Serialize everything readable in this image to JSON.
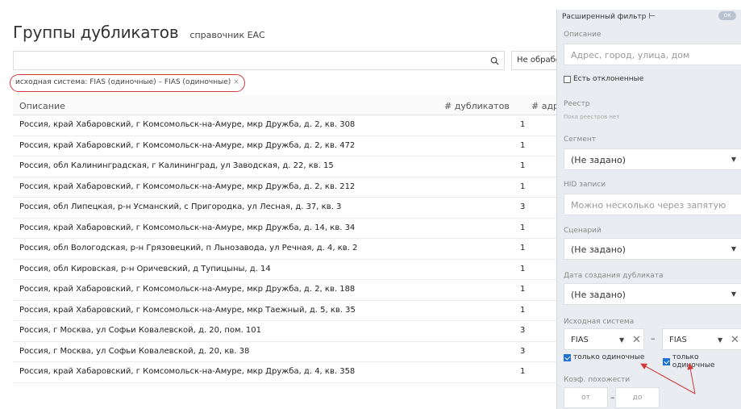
{
  "page": {
    "title": "Группы дубликатов",
    "subtitle": "справочник ЕАС"
  },
  "search": {
    "placeholder": "",
    "status_label": "Не обработ"
  },
  "icons": {
    "search": "search-icon",
    "pin": "pin-icon",
    "close": "close-icon",
    "chevron": "chevron-down-icon"
  },
  "filter_chip": {
    "label": "исходная система: FIAS (одиночные) – FIAS (одиночные)",
    "close": "×"
  },
  "table": {
    "columns": [
      "Описание",
      "# дубликатов",
      "# адре"
    ],
    "rows": [
      {
        "desc": "Россия, край Хабаровский, г Комсомольск-на-Амуре, мкр Дружба, д. 2, кв. 308",
        "count": "1"
      },
      {
        "desc": "Россия, край Хабаровский, г Комсомольск-на-Амуре, мкр Дружба, д. 2, кв. 472",
        "count": "1"
      },
      {
        "desc": "Россия, обл Калининградская, г Калининград, ул Заводская, д. 22, кв. 15",
        "count": "1"
      },
      {
        "desc": "Россия, край Хабаровский, г Комсомольск-на-Амуре, мкр Дружба, д. 2, кв. 212",
        "count": "1"
      },
      {
        "desc": "Россия, обл Липецкая, р-н Усманский, с Пригородка, ул Лесная, д. 37, кв. 3",
        "count": "3"
      },
      {
        "desc": "Россия, край Хабаровский, г Комсомольск-на-Амуре, мкр Дружба, д. 14, кв. 34",
        "count": "1"
      },
      {
        "desc": "Россия, обл Вологодская, р-н Грязовецкий, п Льнозавода, ул Речная, д. 4, кв. 2",
        "count": "1"
      },
      {
        "desc": "Россия, обл Кировская, р-н Оричевский, д Тупицыны, д. 14",
        "count": "1"
      },
      {
        "desc": "Россия, край Хабаровский, г Комсомольск-на-Амуре, мкр Дружба, д. 2, кв. 188",
        "count": "1"
      },
      {
        "desc": "Россия, край Хабаровский, г Комсомольск-на-Амуре, мкр Таежный, д. 5, кв. 35",
        "count": "1"
      },
      {
        "desc": "Россия, г Москва, ул Софьи Ковалевской, д. 20, пом. 101",
        "count": "3"
      },
      {
        "desc": "Россия, г Москва, ул Софьи Ковалевской, д. 20, кв. 38",
        "count": "3"
      },
      {
        "desc": "Россия, край Хабаровский, г Комсомольск-на-Амуре, мкр Дружба, д. 4, кв. 358",
        "count": "1"
      }
    ]
  },
  "panel": {
    "title": "Расширенный фильтр",
    "ok_label": "ОК",
    "description_label": "Описание",
    "description_placeholder": "Адрес, город, улица, дом",
    "rejected_label": "Есть отклоненные",
    "registry_label": "Реестр",
    "registry_hint": "Пока реестров нет",
    "segment_label": "Сегмент",
    "segment_value": "(Не задано)",
    "hid_label": "HID записи",
    "hid_placeholder": "Можно несколько через запятую",
    "scenario_label": "Сценарий",
    "scenario_value": "(Не задано)",
    "created_label": "Дата создания дубликата",
    "created_value": "(Не задано)",
    "source_label": "Исходная система",
    "source_from": "FIAS",
    "source_to": "FIAS",
    "dash": "–",
    "only_single_from": "только одиночные",
    "only_single_to": "только одиночные",
    "similarity_label": "Коэф. похожести",
    "similarity_from_placeholder": "от",
    "similarity_to_placeholder": "до"
  },
  "colors": {
    "annotation_red": "#d23b3b",
    "checkbox_blue": "#1e73d2",
    "panel_bg": "#e9edf1"
  }
}
